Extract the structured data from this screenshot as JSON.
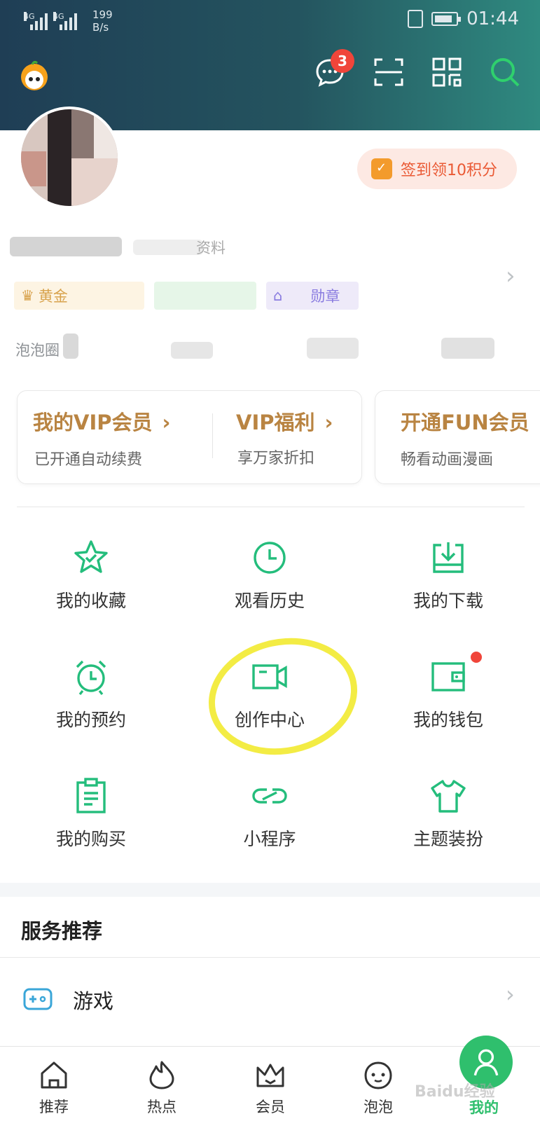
{
  "status_bar": {
    "network_1": "4G",
    "network_2": "4G",
    "speed_value": "199",
    "speed_unit": "B/s",
    "time": "01:44"
  },
  "header": {
    "message_badge": "3",
    "icons": [
      "app-logo-icon",
      "message-icon",
      "scan-icon",
      "qrcode-icon",
      "search-icon"
    ]
  },
  "profile": {
    "signin_label": "签到领10积分",
    "nickname_visible": "资料",
    "tags": [
      "黄金",
      "",
      "勋章"
    ],
    "bubble_label": "泡泡圈"
  },
  "vip": {
    "card1": {
      "title": "我的VIP会员",
      "subtitle": "已开通自动续费",
      "title2": "VIP福利",
      "subtitle2": "享万家折扣"
    },
    "card2": {
      "title": "开通FUN会员",
      "subtitle": "畅看动画漫画"
    }
  },
  "grid": [
    {
      "label": "我的收藏",
      "icon": "star-icon"
    },
    {
      "label": "观看历史",
      "icon": "clock-icon"
    },
    {
      "label": "我的下载",
      "icon": "download-icon"
    },
    {
      "label": "我的预约",
      "icon": "alarm-icon"
    },
    {
      "label": "创作中心",
      "icon": "video-camera-icon"
    },
    {
      "label": "我的钱包",
      "icon": "wallet-icon"
    },
    {
      "label": "我的购买",
      "icon": "clipboard-icon"
    },
    {
      "label": "小程序",
      "icon": "link-icon"
    },
    {
      "label": "主题装扮",
      "icon": "tshirt-icon"
    }
  ],
  "services": {
    "title": "服务推荐",
    "items": [
      {
        "label": "游戏",
        "icon": "gamepad-icon"
      }
    ]
  },
  "nav": {
    "items": [
      {
        "label": "推荐",
        "icon": "home-icon"
      },
      {
        "label": "热点",
        "icon": "flame-icon"
      },
      {
        "label": "会员",
        "icon": "crown-icon"
      },
      {
        "label": "泡泡",
        "icon": "bubble-face-icon"
      },
      {
        "label": "我的",
        "icon": "profile-icon"
      }
    ]
  },
  "watermark": "Baidu经验",
  "colors": {
    "accent": "#2fbf6d",
    "vip_gold": "#b98442",
    "badge_red": "#f0453a",
    "signin_orange": "#ea5a35"
  }
}
